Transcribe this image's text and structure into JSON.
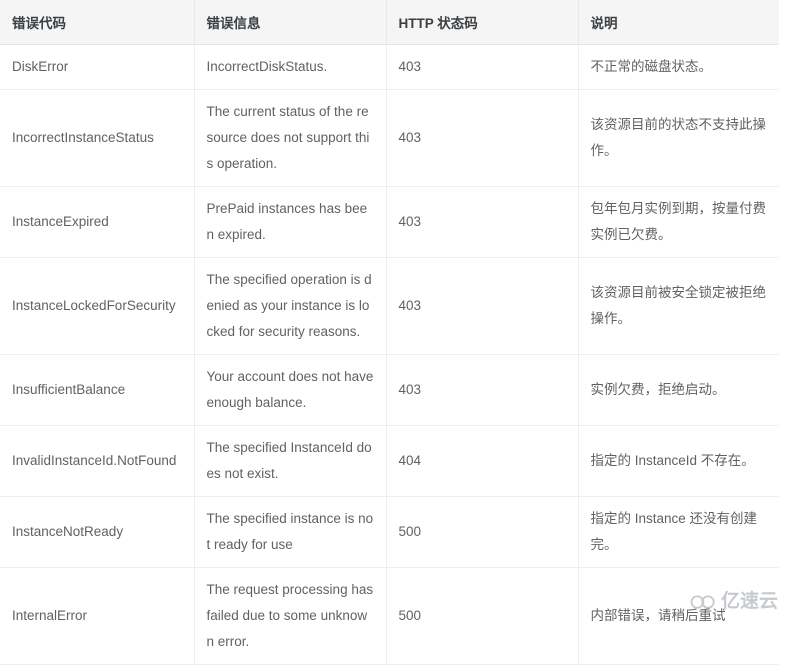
{
  "table": {
    "columns": [
      {
        "key": "code",
        "label": "错误代码"
      },
      {
        "key": "message",
        "label": "错误信息"
      },
      {
        "key": "status",
        "label": "HTTP 状态码"
      },
      {
        "key": "desc",
        "label": "说明"
      }
    ],
    "rows": [
      {
        "code": "DiskError",
        "message": "IncorrectDiskStatus.",
        "status": "403",
        "desc": "不正常的磁盘状态。"
      },
      {
        "code": "IncorrectInstanceStatus",
        "message": "The current status of the resource does not support this operation.",
        "status": "403",
        "desc": "该资源目前的状态不支持此操作。"
      },
      {
        "code": "InstanceExpired",
        "message": "PrePaid instances has been expired.",
        "status": "403",
        "desc": "包年包月实例到期，按量付费实例已欠费。"
      },
      {
        "code": "InstanceLockedForSecurity",
        "message": "The specified operation is denied as your instance is locked for security reasons.",
        "status": "403",
        "desc": "该资源目前被安全锁定被拒绝操作。"
      },
      {
        "code": "InsufficientBalance",
        "message": "Your account does not have enough balance.",
        "status": "403",
        "desc": "实例欠费，拒绝启动。"
      },
      {
        "code": "InvalidInstanceId.NotFound",
        "message": "The specified InstanceId does not exist.",
        "status": "404",
        "desc": "指定的 InstanceId 不存在。"
      },
      {
        "code": "InstanceNotReady",
        "message": "The specified instance is not ready for use",
        "status": "500",
        "desc": "指定的 Instance 还没有创建完。"
      },
      {
        "code": "InternalError",
        "message": "The request processing has failed due to some unknown error.",
        "status": "500",
        "desc": "内部错误，请稍后重试"
      }
    ]
  },
  "watermark": {
    "text": "亿速云",
    "icon": "cloud-logo-icon",
    "color": "#9aa0a6"
  },
  "colors": {
    "header_background": "#f5f5f5",
    "header_text": "#3b3f42",
    "body_text": "#5f6265",
    "border": "#eeeeee",
    "page_background": "#ffffff"
  }
}
